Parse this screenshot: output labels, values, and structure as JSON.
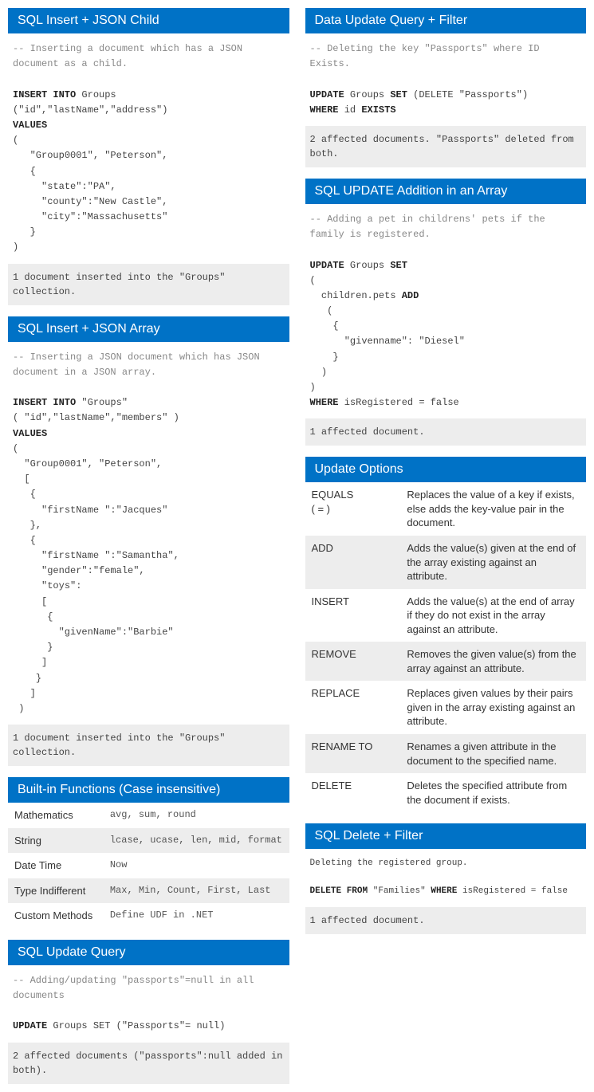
{
  "left": {
    "card1": {
      "title": "SQL Insert + JSON Child",
      "comment": "-- Inserting a document which has a JSON document as a child.",
      "kw_insert": "INSERT INTO",
      "tbl": " Groups",
      "cols": "(\"id\",\"lastName\",\"address\")",
      "kw_values": "VALUES",
      "body": "(\n   \"Group0001\", \"Peterson\",\n   {\n     \"state\":\"PA\",\n     \"county\":\"New Castle\",\n     \"city\":\"Massachusetts\"\n   }\n)",
      "result": "1 document inserted into the \"Groups\" collection."
    },
    "card2": {
      "title": "SQL Insert + JSON Array",
      "comment": "-- Inserting a JSON document which has JSON document in a JSON array.",
      "kw_insert": "INSERT INTO",
      "tbl": " \"Groups\"",
      "cols": "( \"id\",\"lastName\",\"members\" )",
      "kw_values": "VALUES",
      "body": "(\n  \"Group0001\", \"Peterson\",\n  [\n   {\n     \"firstName \":\"Jacques\"\n   },\n   {\n     \"firstName \":\"Samantha\",\n     \"gender\":\"female\",\n     \"toys\":\n     [\n      {\n        \"givenName\":\"Barbie\"\n      }\n     ]\n    }\n   ]\n )",
      "result": "1 document inserted into the \"Groups\" collection."
    },
    "card3": {
      "title": "Built-in Functions (Case insensitive)",
      "rows": [
        {
          "k": "Mathematics",
          "v": "avg, sum, round"
        },
        {
          "k": "String",
          "v": "lcase, ucase, len, mid, format"
        },
        {
          "k": "Date Time",
          "v": "Now"
        },
        {
          "k": "Type Indifferent",
          "v": "Max, Min, Count, First, Last"
        },
        {
          "k": "Custom Methods",
          "v": "Define UDF in .NET"
        }
      ]
    },
    "card4": {
      "title": "SQL Update Query",
      "comment": "-- Adding/updating \"passports\"=null in all documents",
      "kw_update": "UPDATE",
      "mid": " Groups SET (\"Passports\"= null)",
      "result": "2 affected documents (\"passports\":null added in both)."
    }
  },
  "right": {
    "card1": {
      "title": "Data Update Query + Filter",
      "comment": "-- Deleting the key \"Passports\" where ID Exists.",
      "kw_update": "UPDATE",
      "mid1": " Groups ",
      "kw_set": "SET",
      "mid2": " (DELETE \"Passports\")",
      "kw_where": "WHERE",
      "mid3": " id ",
      "kw_exists": "EXISTS",
      "result": "2 affected documents. \"Passports\" deleted from both."
    },
    "card2": {
      "title": "SQL UPDATE Addition in an Array",
      "comment": "-- Adding a pet in childrens' pets if the family is registered.",
      "kw_update": "UPDATE",
      "mid1": " Groups ",
      "kw_set": "SET",
      "body1": "\n(\n  children.pets ",
      "kw_add": "ADD",
      "body2": "\n   (\n    {\n      \"givenname\": \"Diesel\"\n    }\n  )\n)\n",
      "kw_where": "WHERE",
      "cond": " isRegistered = false",
      "result": "1 affected document."
    },
    "card3": {
      "title": "Update Options",
      "rows": [
        {
          "k": "EQUALS\n( = )",
          "v": "Replaces the value of a key if exists, else adds the key-value pair in the document."
        },
        {
          "k": "ADD",
          "v": "Adds the value(s) given at the end of the array existing against an attribute."
        },
        {
          "k": "INSERT",
          "v": "Adds the value(s) at the end of array if they do not exist in the array against an attribute."
        },
        {
          "k": "REMOVE",
          "v": "Removes the given value(s) from the array against an attribute."
        },
        {
          "k": "REPLACE",
          "v": "Replaces given values by their pairs given in the array existing against an attribute."
        },
        {
          "k": "RENAME TO",
          "v": "Renames a given attribute in the document to the specified name."
        },
        {
          "k": "DELETE",
          "v": "Deletes the specified attribute from the document if exists."
        }
      ]
    },
    "card4": {
      "title": "SQL Delete + Filter",
      "comment": "Deleting the registered group.",
      "kw_delete": "DELETE FROM",
      "mid1": " \"Families\" ",
      "kw_where": "WHERE",
      "cond": " isRegistered = false",
      "result": "1 affected document."
    }
  }
}
